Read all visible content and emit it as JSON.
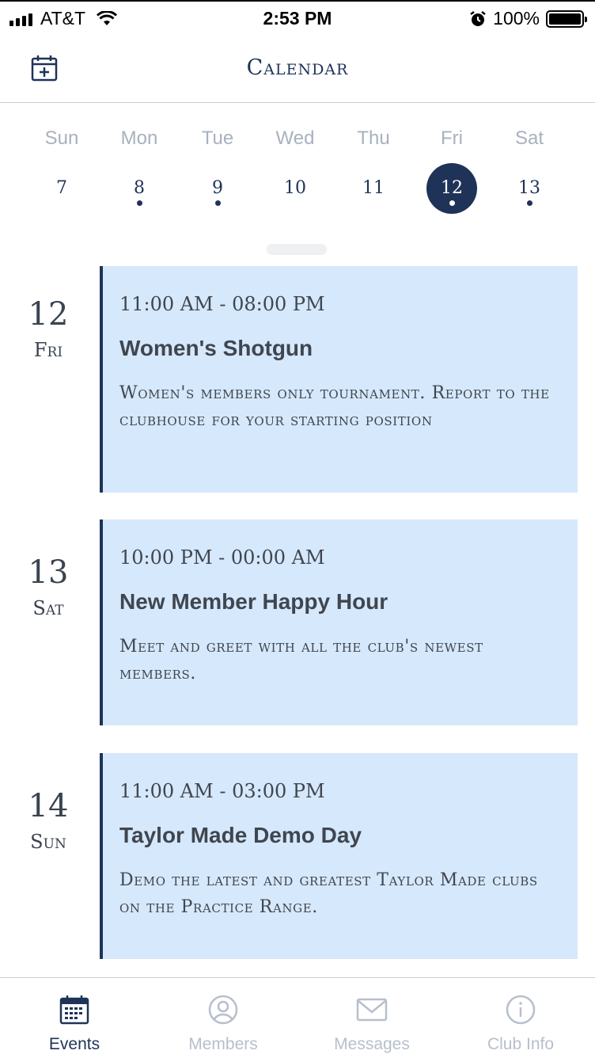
{
  "status_bar": {
    "carrier": "AT&T",
    "time": "2:53 PM",
    "battery": "100%"
  },
  "header": {
    "title": "Calendar",
    "add_icon": "calendar-plus-icon"
  },
  "week": {
    "days": [
      {
        "name": "Sun",
        "num": "7",
        "has_event": false,
        "selected": false
      },
      {
        "name": "Mon",
        "num": "8",
        "has_event": true,
        "selected": false
      },
      {
        "name": "Tue",
        "num": "9",
        "has_event": true,
        "selected": false
      },
      {
        "name": "Wed",
        "num": "10",
        "has_event": false,
        "selected": false
      },
      {
        "name": "Thu",
        "num": "11",
        "has_event": false,
        "selected": false
      },
      {
        "name": "Fri",
        "num": "12",
        "has_event": true,
        "selected": true
      },
      {
        "name": "Sat",
        "num": "13",
        "has_event": true,
        "selected": false
      }
    ]
  },
  "events": [
    {
      "day_num": "12",
      "day_name": "Fri",
      "time": "11:00 AM - 08:00 PM",
      "title": "Women's Shotgun",
      "description": "Women's members only tournament. Report to the clubhouse for your starting position"
    },
    {
      "day_num": "13",
      "day_name": "Sat",
      "time": "10:00 PM - 00:00 AM",
      "title": "New Member Happy Hour",
      "description": "Meet and greet with all the club's newest members."
    },
    {
      "day_num": "14",
      "day_name": "Sun",
      "time": "11:00 AM - 03:00 PM",
      "title": "Taylor Made Demo Day",
      "description": "Demo the latest and greatest Taylor Made clubs on the Practice Range."
    }
  ],
  "tabbar": {
    "tabs": [
      {
        "label": "Events",
        "icon": "calendar-icon",
        "active": true
      },
      {
        "label": "Members",
        "icon": "user-circle-icon",
        "active": false
      },
      {
        "label": "Messages",
        "icon": "envelope-icon",
        "active": false
      },
      {
        "label": "Club Info",
        "icon": "info-circle-icon",
        "active": false
      }
    ]
  },
  "colors": {
    "navy": "#1f3358",
    "card_bg": "#d6e8fb",
    "muted": "#b7bfcc"
  }
}
